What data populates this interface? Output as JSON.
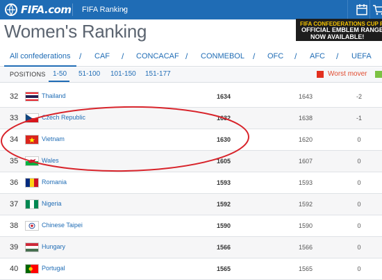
{
  "header": {
    "logo_text": "FIFA.com",
    "nav_label": "FIFA Ranking",
    "icons": [
      "calendar-icon",
      "cart-icon"
    ]
  },
  "page": {
    "title": "Women's Ranking"
  },
  "promo": {
    "line1": "FIFA CONFEDERATIONS CUP RUSSIA",
    "line2": "OFFICIAL EMBLEM RANGE",
    "line3": "NOW AVAILABLE!"
  },
  "confederations": [
    "All confederations",
    "CAF",
    "CONCACAF",
    "CONMEBOL",
    "OFC",
    "AFC",
    "UEFA"
  ],
  "positions": {
    "label": "POSITIONS",
    "ranges": [
      "1-50",
      "51-100",
      "101-150",
      "151-177"
    ],
    "active": "1-50"
  },
  "legend": {
    "worst_mover": "Worst mover",
    "worst_color": "#e3301f",
    "best_color": "#7cc243"
  },
  "table": {
    "rows": [
      {
        "rank": "32",
        "team": "Thailand",
        "flag": "thailand",
        "points": "1634",
        "previous": "1643",
        "movement": "-2"
      },
      {
        "rank": "33",
        "team": "Czech Republic",
        "flag": "czech",
        "points": "1632",
        "previous": "1638",
        "movement": "-1"
      },
      {
        "rank": "34",
        "team": "Vietnam",
        "flag": "vietnam",
        "points": "1630",
        "previous": "1620",
        "movement": "0"
      },
      {
        "rank": "35",
        "team": "Wales",
        "flag": "wales",
        "points": "1605",
        "previous": "1607",
        "movement": "0"
      },
      {
        "rank": "36",
        "team": "Romania",
        "flag": "romania",
        "points": "1593",
        "previous": "1593",
        "movement": "0"
      },
      {
        "rank": "37",
        "team": "Nigeria",
        "flag": "nigeria",
        "points": "1592",
        "previous": "1592",
        "movement": "0"
      },
      {
        "rank": "38",
        "team": "Chinese Taipei",
        "flag": "chinese-taipei",
        "points": "1590",
        "previous": "1590",
        "movement": "0"
      },
      {
        "rank": "39",
        "team": "Hungary",
        "flag": "hungary",
        "points": "1566",
        "previous": "1566",
        "movement": "0"
      },
      {
        "rank": "40",
        "team": "Portugal",
        "flag": "portugal",
        "points": "1565",
        "previous": "1565",
        "movement": "0"
      }
    ]
  },
  "annotation": {
    "type": "hand-drawn-ellipse",
    "color": "#d8232a",
    "highlighted_team": "Vietnam"
  }
}
